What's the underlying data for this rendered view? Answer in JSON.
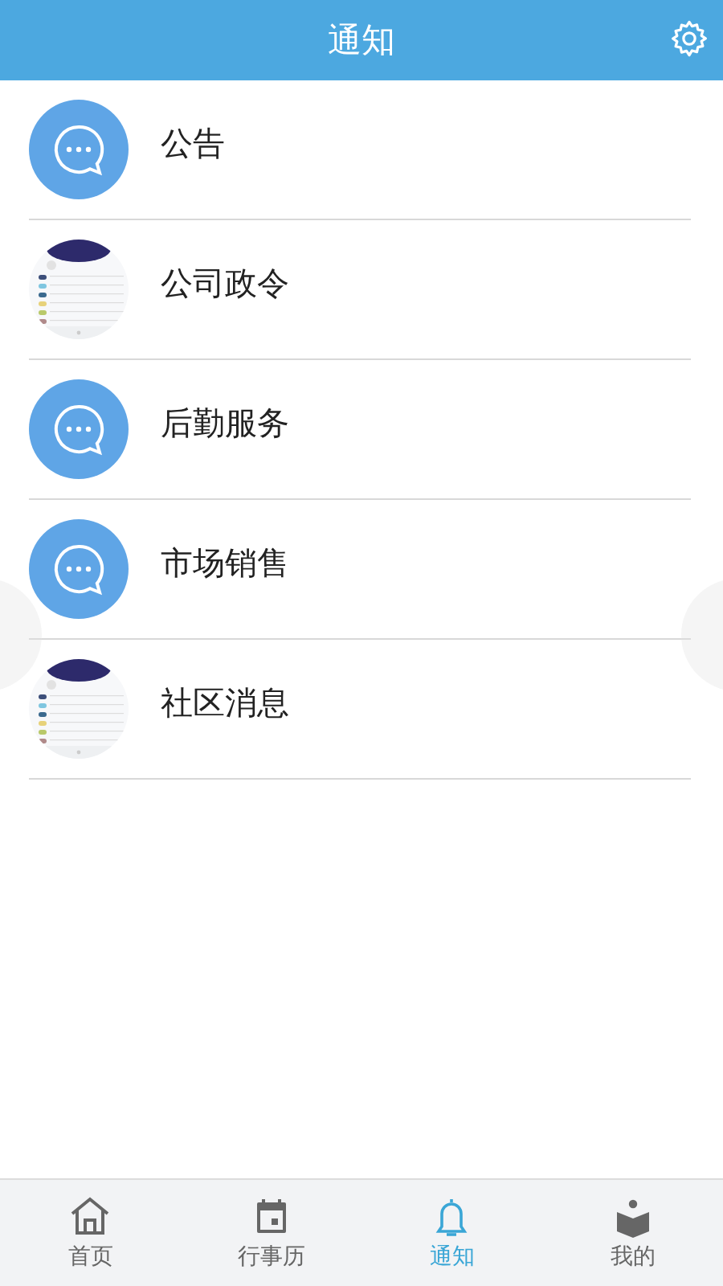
{
  "header": {
    "title": "通知"
  },
  "items": [
    {
      "title": "公告",
      "kind": "chat"
    },
    {
      "title": "公司政令",
      "kind": "picture"
    },
    {
      "title": "后勤服务",
      "kind": "chat"
    },
    {
      "title": "市场销售",
      "kind": "chat"
    },
    {
      "title": "社区消息",
      "kind": "picture"
    }
  ],
  "tabs": [
    {
      "label": "首页",
      "kind": "home",
      "selected": false
    },
    {
      "label": "行事历",
      "kind": "calendar",
      "selected": false
    },
    {
      "label": "通知",
      "kind": "bell",
      "selected": true
    },
    {
      "label": "我的",
      "kind": "reader",
      "selected": false
    }
  ]
}
